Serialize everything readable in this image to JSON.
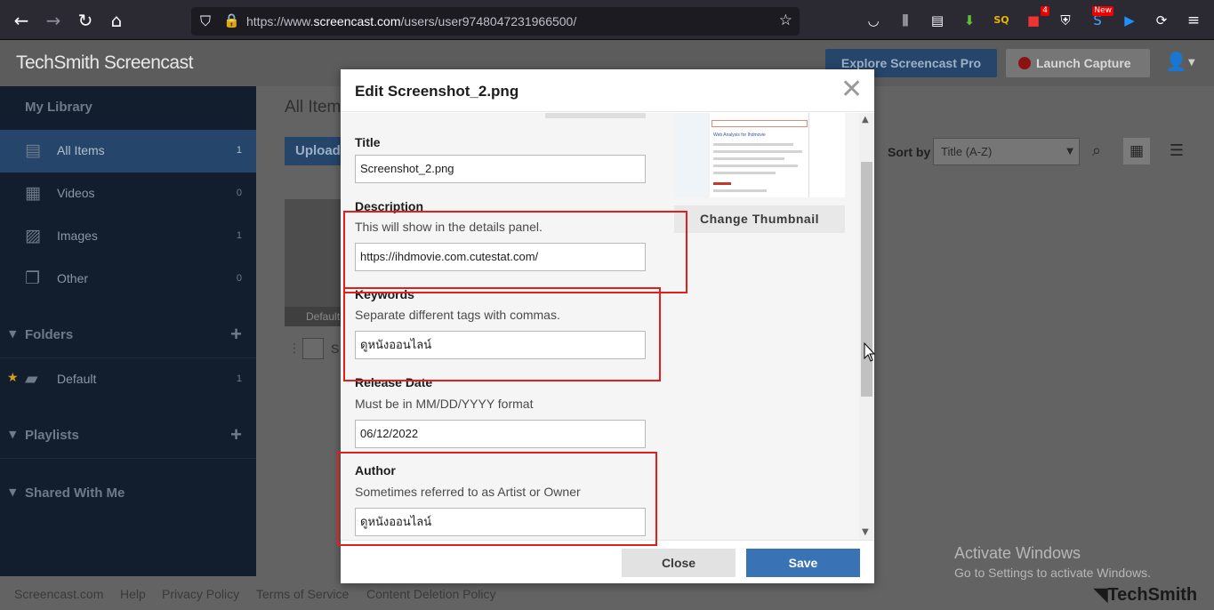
{
  "browser": {
    "back": "←",
    "forward": "→",
    "reload": "↻",
    "home": "⌂",
    "url_prefix": "https://www.",
    "url_host": "screencast.com",
    "url_path": "/users/user9748047231966500/",
    "ext_badge_count": "4",
    "ext_badge_new": "New"
  },
  "header": {
    "logo": "TechSmith Screencast",
    "explore_label": "Explore Screencast Pro",
    "launch_label": "Launch Capture"
  },
  "sidebar": {
    "library_title": "My Library",
    "items": [
      {
        "label": "All Items",
        "count": "1"
      },
      {
        "label": "Videos",
        "count": "0"
      },
      {
        "label": "Images",
        "count": "1"
      },
      {
        "label": "Other",
        "count": "0"
      }
    ],
    "folders_label": "Folders",
    "default_folder": {
      "label": "Default",
      "count": "1"
    },
    "playlists_label": "Playlists",
    "shared_label": "Shared With Me"
  },
  "main": {
    "title": "All Items",
    "upload_label": "Upload",
    "sort_label": "Sort by",
    "sort_value": "Title (A-Z)",
    "thumb_folder": "Default",
    "item_letter": "S"
  },
  "modal": {
    "title": "Edit Screenshot_2.png",
    "title_label": "Title",
    "title_value": "Screenshot_2.png",
    "description_label": "Description",
    "description_help": "This will show in the details panel.",
    "description_value": "https://ihdmovie.com.cutestat.com/",
    "keywords_label": "Keywords",
    "keywords_help": "Separate different tags with commas.",
    "keywords_value": "ดูหนังออนไลน์",
    "release_label": "Release Date",
    "release_help": "Must be in MM/DD/YYYY format",
    "release_value": "06/12/2022",
    "author_label": "Author",
    "author_help": "Sometimes referred to as Artist or Owner",
    "author_value": "ดูหนังออนไลน์",
    "change_thumbnail_label": "Change Thumbnail",
    "preview_heading": "Web Analysis for Ihdmovie",
    "close_label": "Close",
    "save_label": "Save"
  },
  "footer": {
    "links": [
      "Screencast.com",
      "Help",
      "Privacy Policy",
      "Terms of Service",
      "Content Deletion Policy"
    ],
    "brand": "TechSmith"
  },
  "watermark": {
    "line1": "Activate Windows",
    "line2": "Go to Settings to activate Windows."
  },
  "colors": {
    "highlight": "#e21f1f",
    "save": "#3a73b5",
    "active_sidebar": "#26456a"
  }
}
